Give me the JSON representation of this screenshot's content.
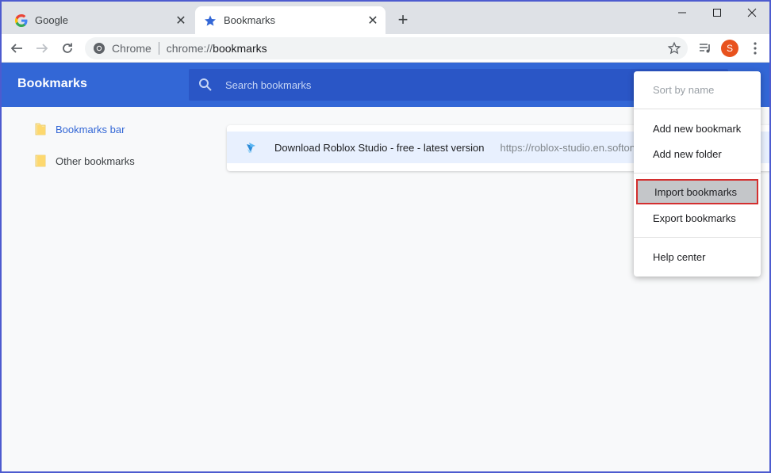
{
  "tabs": [
    {
      "title": "Google",
      "icon": "google-g-icon",
      "active": false
    },
    {
      "title": "Bookmarks",
      "icon": "star-icon",
      "active": true
    }
  ],
  "toolbar": {
    "chip": "Chrome",
    "url_prefix": "chrome://",
    "url_host": "bookmarks",
    "avatar_initial": "S"
  },
  "header": {
    "title": "Bookmarks",
    "search_placeholder": "Search bookmarks"
  },
  "sidebar": {
    "items": [
      {
        "label": "Bookmarks bar",
        "selected": true
      },
      {
        "label": "Other bookmarks",
        "selected": false
      }
    ]
  },
  "bookmarks": [
    {
      "name": "Download Roblox Studio - free - latest version",
      "url": "https://roblox-studio.en.softonic.com/"
    }
  ],
  "menu": {
    "sort_by_name": "Sort by name",
    "add_new_bookmark": "Add new bookmark",
    "add_new_folder": "Add new folder",
    "import_bookmarks": "Import bookmarks",
    "export_bookmarks": "Export bookmarks",
    "help_center": "Help center"
  },
  "colors": {
    "header_blue": "#3367d6",
    "search_blue": "#2a56c6",
    "highlight_border": "#d32f2f",
    "avatar": "#e8521e"
  }
}
